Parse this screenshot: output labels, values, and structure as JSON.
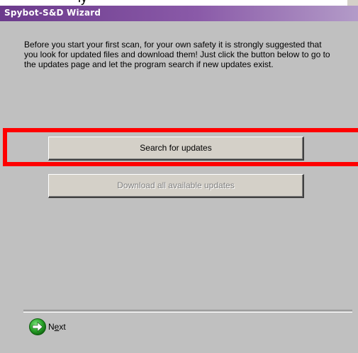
{
  "window": {
    "title": "Spybot-S&D Wizard",
    "top_strip_partial_text": "ly"
  },
  "intro": {
    "text": "Before you start your first scan, for your own safety it is strongly suggested that you look for updated files and download them! Just click the button below to go to the updates page and let the program search if new updates exist."
  },
  "buttons": {
    "search_label": "Search for updates",
    "download_label": "Download all available updates",
    "download_enabled": false
  },
  "next": {
    "label_prefix": "N",
    "label_accel": "e",
    "label_suffix": "xt",
    "icon": "green-arrow-right-icon"
  },
  "colors": {
    "title_gradient_start": "#6b3a8c",
    "panel_bg": "#c0c0c0",
    "highlight": "#ff0000",
    "next_icon_green": "#2aa52a"
  }
}
